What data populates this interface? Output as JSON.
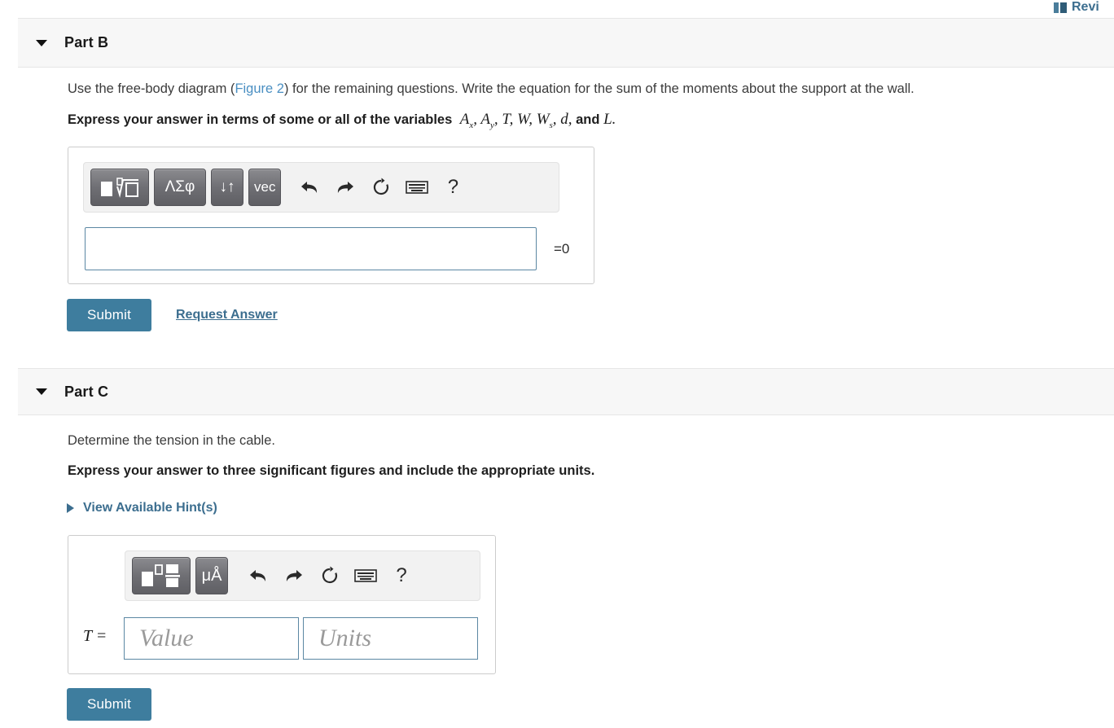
{
  "topbar": {
    "review_label": "Revi",
    "review_icon": "book-icon"
  },
  "parts": [
    {
      "id": "part-b",
      "title": "Part B",
      "prompt_before_link": "Use the free-body diagram (",
      "figure_link": "Figure 2",
      "prompt_after_link": ") for the remaining questions. Write the equation for the sum of the moments about the support at the wall.",
      "instruction_prefix": "Express your answer in terms of some or all of the variables",
      "variables": [
        "A",
        "A",
        "T",
        "W",
        "W",
        "d",
        "L"
      ],
      "variables_display": "A_x, A_y, T, W, W_s, d, and L.",
      "conjunction": "and",
      "toolbar": {
        "buttons": [
          {
            "name": "template-radical-button",
            "label": "▪√▫"
          },
          {
            "name": "greek-letters-button",
            "label": "ΛΣφ"
          },
          {
            "name": "subscript-superscript-button",
            "label": "↓↑"
          },
          {
            "name": "vector-button",
            "label": "vec"
          }
        ],
        "actions": [
          {
            "name": "undo-icon",
            "label": "undo"
          },
          {
            "name": "redo-icon",
            "label": "redo"
          },
          {
            "name": "reset-icon",
            "label": "reset"
          },
          {
            "name": "keyboard-icon",
            "label": "keyboard"
          },
          {
            "name": "help-icon",
            "label": "?"
          }
        ]
      },
      "input_value": "",
      "suffix": "=0",
      "submit_label": "Submit",
      "request_answer_label": "Request Answer"
    },
    {
      "id": "part-c",
      "title": "Part C",
      "prompt": "Determine the tension in the cable.",
      "instruction": "Express your answer to three significant figures and include the appropriate units.",
      "hints_label": "View Available Hint(s)",
      "toolbar": {
        "buttons": [
          {
            "name": "template-exponent-fraction-button",
            "label": "▪▫/▫"
          },
          {
            "name": "units-button",
            "label": "μÅ"
          }
        ],
        "actions": [
          {
            "name": "undo-icon",
            "label": "undo"
          },
          {
            "name": "redo-icon",
            "label": "redo"
          },
          {
            "name": "reset-icon",
            "label": "reset"
          },
          {
            "name": "keyboard-icon",
            "label": "keyboard"
          },
          {
            "name": "help-icon",
            "label": "?"
          }
        ]
      },
      "answer_label": "T =",
      "value_placeholder": "Value",
      "units_placeholder": "Units",
      "value_input": "",
      "units_input": "",
      "submit_label": "Submit"
    }
  ],
  "colors": {
    "link": "#3c6e8f",
    "figure_link": "#4a8fc2",
    "submit_bg": "#3e7d9e",
    "header_bg": "#f7f7f7",
    "input_border": "#5b87a3"
  }
}
